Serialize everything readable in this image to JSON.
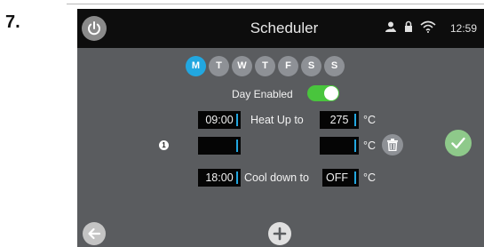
{
  "step_number": "7.",
  "header": {
    "title": "Scheduler",
    "time": "12:59",
    "icons": [
      "power-icon",
      "user-icon",
      "lock-icon",
      "wifi-icon"
    ]
  },
  "days": [
    {
      "label": "M",
      "active": true
    },
    {
      "label": "T",
      "active": false
    },
    {
      "label": "W",
      "active": false
    },
    {
      "label": "T",
      "active": false
    },
    {
      "label": "F",
      "active": false
    },
    {
      "label": "S",
      "active": false
    },
    {
      "label": "S",
      "active": false
    }
  ],
  "day_enabled": {
    "label": "Day Enabled",
    "on": true
  },
  "rows": [
    {
      "time": "09:00",
      "action": "Heat Up to",
      "temp": "275",
      "unit": "°C"
    },
    {
      "time": "",
      "action": "",
      "temp": "",
      "unit": "°C",
      "marker": "1"
    },
    {
      "time": "18:00",
      "action": "Cool down to",
      "temp": "OFF",
      "unit": "°C"
    }
  ],
  "colors": {
    "accent": "#22a7e0",
    "toggle_on": "#49c53d",
    "confirm": "#8ec98a",
    "screen_bg": "#5a5c5f",
    "titlebar": "#0d0d0d"
  }
}
